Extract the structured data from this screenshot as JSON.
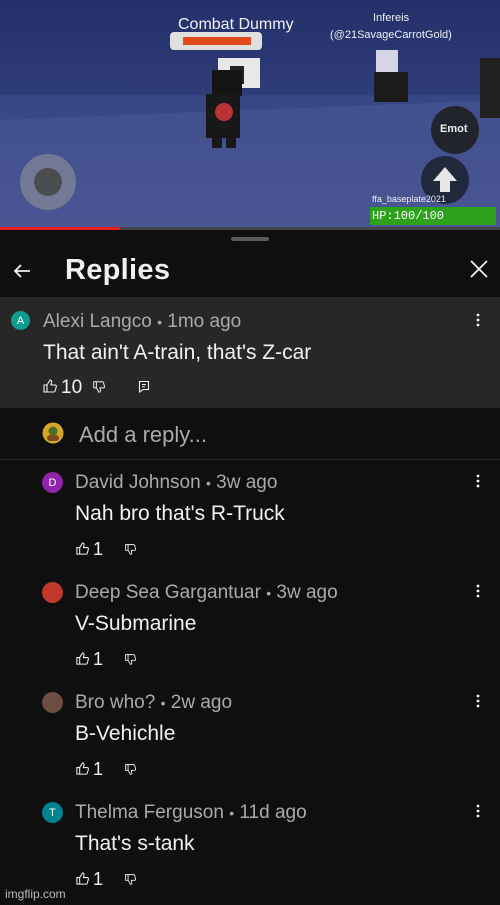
{
  "video": {
    "enemy_name": "Combat Dummy",
    "player_name": "Infereis",
    "player_handle": "(@21SavageCarrotGold)",
    "emote_label": "Emot",
    "map_label": "ffa_baseplate2021",
    "hp_text": "HP:100/100",
    "progress_percent": 24,
    "colors": {
      "sky": "#3a4987",
      "progress": "#e62117",
      "hp": "#2db01c"
    }
  },
  "header": {
    "title": "Replies",
    "back_icon": "arrow-left-icon",
    "close_icon": "close-icon"
  },
  "parent_comment": {
    "avatar_letter": "A",
    "avatar_color": "#0f9b8e",
    "author": "Alexi Langco",
    "time": "1mo ago",
    "text": "That ain't A-train, that's Z-car",
    "likes": "10"
  },
  "add_reply": {
    "placeholder": "Add a reply..."
  },
  "replies": [
    {
      "avatar_letter": "D",
      "avatar_color": "#8e24aa",
      "author": "David Johnson",
      "time": "3w ago",
      "text": "Nah bro that's R-Truck",
      "likes": "1"
    },
    {
      "avatar_letter": "",
      "avatar_color": "#c0392b",
      "author": "Deep Sea Gargantuar",
      "time": "3w ago",
      "text": "V-Submarine",
      "likes": "1"
    },
    {
      "avatar_letter": "",
      "avatar_color": "#6d4c41",
      "author": "Bro who?",
      "time": "2w ago",
      "text": "B-Vehichle",
      "likes": "1"
    },
    {
      "avatar_letter": "T",
      "avatar_color": "#00838f",
      "author": "Thelma Ferguson",
      "time": "11d ago",
      "text": "That's s-tank",
      "likes": "1"
    }
  ],
  "separator": "•",
  "watermark": "imgflip.com"
}
